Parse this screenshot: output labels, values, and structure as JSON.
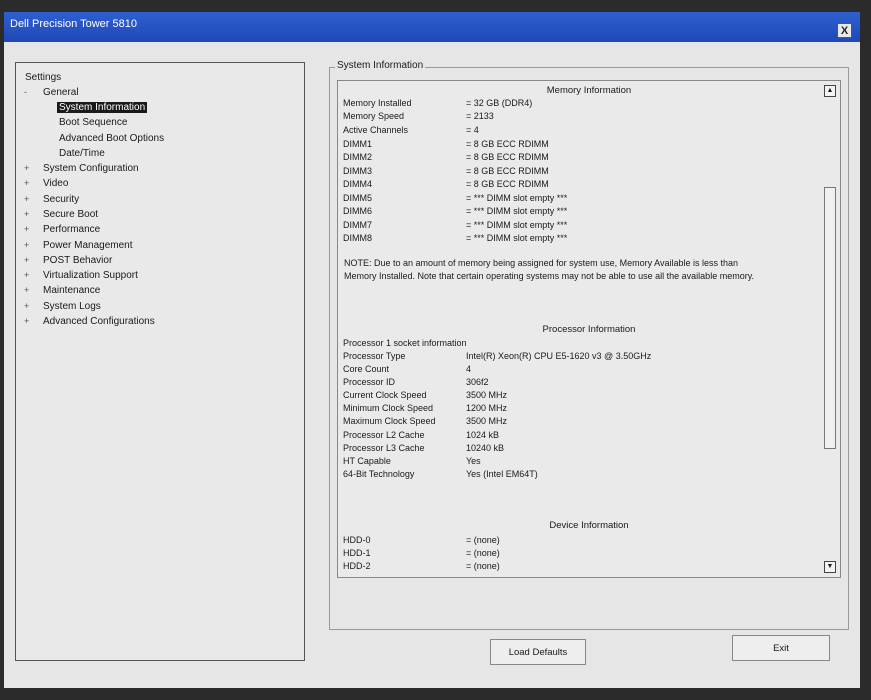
{
  "window": {
    "title": "Dell Precision Tower 5810",
    "close_label": "X"
  },
  "tree": {
    "root": "Settings",
    "general": "General",
    "general_children": [
      "System Information",
      "Boot Sequence",
      "Advanced Boot Options",
      "Date/Time"
    ],
    "items": [
      "System Configuration",
      "Video",
      "Security",
      "Secure Boot",
      "Performance",
      "Power Management",
      "POST Behavior",
      "Virtualization Support",
      "Maintenance",
      "System Logs",
      "Advanced Configurations"
    ],
    "expand_glyph": "+",
    "collapse_glyph": "-"
  },
  "section": {
    "title": "System Information"
  },
  "memory": {
    "header": "Memory Information",
    "rows": [
      {
        "label": "Memory Installed",
        "value": "= 32 GB (DDR4)"
      },
      {
        "label": "Memory Speed",
        "value": "= 2133"
      },
      {
        "label": "Active Channels",
        "value": "= 4"
      },
      {
        "label": "DIMM1",
        "value": "= 8 GB ECC RDIMM"
      },
      {
        "label": "DIMM2",
        "value": "= 8 GB ECC RDIMM"
      },
      {
        "label": "DIMM3",
        "value": "= 8 GB ECC RDIMM"
      },
      {
        "label": "DIMM4",
        "value": "= 8 GB ECC RDIMM"
      },
      {
        "label": "DIMM5",
        "value": "= *** DIMM slot empty ***"
      },
      {
        "label": "DIMM6",
        "value": "= *** DIMM slot empty ***"
      },
      {
        "label": "DIMM7",
        "value": "= *** DIMM slot empty ***"
      },
      {
        "label": "DIMM8",
        "value": "= *** DIMM slot empty ***"
      }
    ],
    "note": "NOTE: Due to an amount of memory being assigned for system use, Memory Available is less than Memory Installed. Note that certain operating systems may not be able to use all the available memory."
  },
  "processor": {
    "header": "Processor Information",
    "socket_label": "Processor 1 socket information",
    "rows": [
      {
        "label": "Processor Type",
        "value": "Intel(R) Xeon(R) CPU E5-1620 v3 @ 3.50GHz"
      },
      {
        "label": "Core Count",
        "value": "4"
      },
      {
        "label": "Processor ID",
        "value": "306f2"
      },
      {
        "label": "Current Clock Speed",
        "value": "3500 MHz"
      },
      {
        "label": "Minimum Clock Speed",
        "value": "1200 MHz"
      },
      {
        "label": "Maximum Clock Speed",
        "value": "3500 MHz"
      },
      {
        "label": "Processor L2 Cache",
        "value": "1024 kB"
      },
      {
        "label": "Processor L3 Cache",
        "value": "10240 kB"
      },
      {
        "label": "HT Capable",
        "value": "Yes"
      },
      {
        "label": "64-Bit Technology",
        "value": "Yes (Intel EM64T)"
      }
    ]
  },
  "device": {
    "header": "Device Information",
    "rows": [
      {
        "label": "HDD-0",
        "value": "= (none)"
      },
      {
        "label": "HDD-1",
        "value": "= (none)"
      },
      {
        "label": "HDD-2",
        "value": "= (none)"
      }
    ]
  },
  "buttons": {
    "load_defaults": "Load Defaults",
    "exit": "Exit"
  },
  "scroll": {
    "up_glyph": "▲",
    "down_glyph": "▼"
  }
}
